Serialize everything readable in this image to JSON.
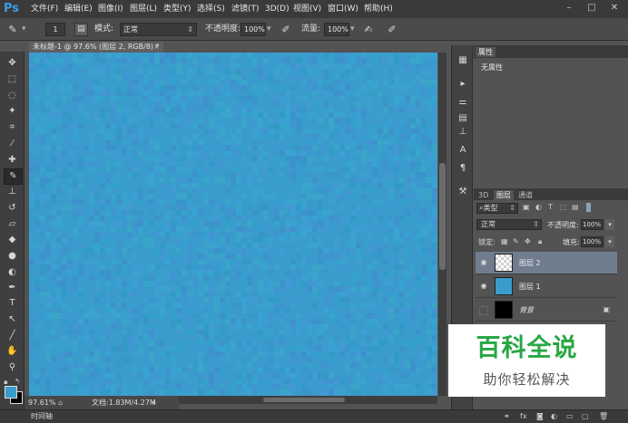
{
  "app": {
    "logo": "Ps",
    "accent": "#3c9ce0"
  },
  "menu": [
    "文件(F)",
    "编辑(E)",
    "图像(I)",
    "图层(L)",
    "类型(Y)",
    "选择(S)",
    "滤镜(T)",
    "3D(D)",
    "视图(V)",
    "窗口(W)",
    "帮助(H)"
  ],
  "window_controls": {
    "minimize": "–",
    "maximize": "□",
    "close": "✕"
  },
  "options": {
    "brush_size": "1",
    "mode_label": "模式:",
    "mode_value": "正常",
    "opacity_label": "不透明度:",
    "opacity_value": "100%",
    "flow_label": "流量:",
    "flow_value": "100%"
  },
  "document": {
    "tab_title": "未标题-1 @ 97.6% (图层 2, RGB/8) *",
    "tab_close": "×",
    "canvas_color": "#3a9ccd",
    "zoom": "97.61%",
    "doc_info": "文档:1.83M/4.27M"
  },
  "timeline": {
    "label": "时间轴"
  },
  "properties": {
    "tab": "属性",
    "text": "无属性"
  },
  "layers_panel": {
    "tabs": [
      "3D",
      "图层",
      "通道"
    ],
    "filter_type": "类型",
    "blend_mode": "正常",
    "opacity_label": "不透明度:",
    "opacity_value": "100%",
    "lock_label": "锁定:",
    "fill_label": "填充:",
    "fill_value": "100%",
    "layers": [
      {
        "name": "图层 2",
        "visible": true,
        "selected": true,
        "thumb": "transparent"
      },
      {
        "name": "图层 1",
        "visible": true,
        "selected": false,
        "thumb": "#3a9ccd"
      },
      {
        "name": "背景",
        "visible": false,
        "selected": false,
        "thumb": "#000000",
        "locked": true
      }
    ]
  },
  "watermark": {
    "title": "百科全说",
    "subtitle": "助你轻松解决"
  }
}
